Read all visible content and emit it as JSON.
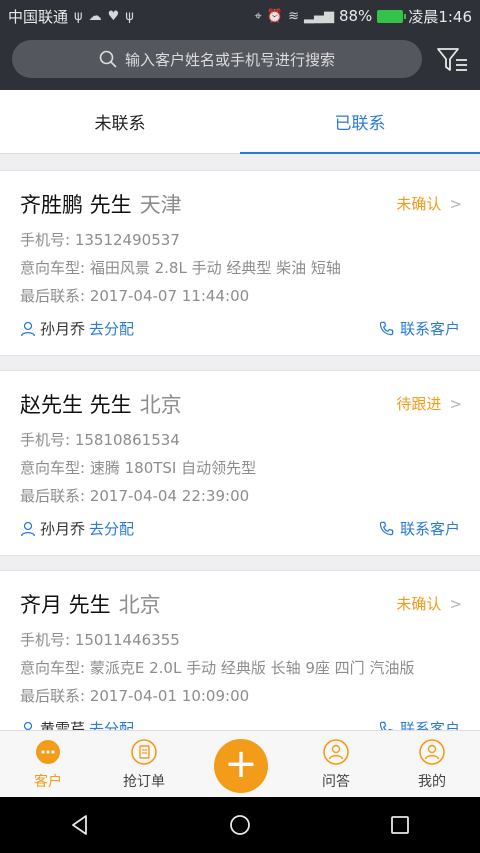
{
  "statusbar": {
    "carrier": "中国联通",
    "battery": "88%",
    "time": "凌晨1:46"
  },
  "search": {
    "placeholder": "输入客户姓名或手机号进行搜索"
  },
  "tabs": [
    {
      "label": "未联系",
      "active": false
    },
    {
      "label": "已联系",
      "active": true
    }
  ],
  "labels": {
    "phone": "手机号:",
    "model": "意向车型:",
    "last": "最后联系:",
    "assign": "去分配",
    "contact": "联系客户"
  },
  "customers": [
    {
      "name": "齐胜鹏 先生",
      "city": "天津",
      "status": "未确认",
      "phone": "13512490537",
      "model": "福田风景 2.8L 手动 经典型 柴油 短轴",
      "last": "2017-04-07 11:44:00",
      "owner": "孙月乔"
    },
    {
      "name": "赵先生 先生",
      "city": "北京",
      "status": "待跟进",
      "phone": "15810861534",
      "model": "速腾 180TSI 自动领先型",
      "last": "2017-04-04 22:39:00",
      "owner": "孙月乔"
    },
    {
      "name": "齐月 先生",
      "city": "北京",
      "status": "未确认",
      "phone": "15011446355",
      "model": "蒙派克E 2.0L 手动 经典版 长轴 9座 四门 汽油版",
      "last": "2017-04-01 10:09:00",
      "owner": "黄雪芹"
    }
  ],
  "bottomnav": [
    {
      "label": "客户",
      "icon": "customer-icon",
      "active": true
    },
    {
      "label": "抢订单",
      "icon": "grab-order-icon",
      "active": false
    },
    {
      "label": "",
      "icon": "plus-icon",
      "active": false
    },
    {
      "label": "问答",
      "icon": "qa-icon",
      "active": false
    },
    {
      "label": "我的",
      "icon": "profile-icon",
      "active": false
    }
  ],
  "colors": {
    "accent": "#2a7bd6",
    "orange": "#f39c1a",
    "header": "#2f3138"
  }
}
